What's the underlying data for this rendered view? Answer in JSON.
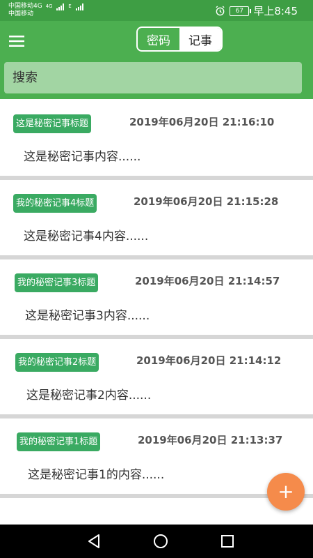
{
  "status_bar": {
    "carrier_line1": "中国移动4G",
    "carrier_line2": "中国移动",
    "net_type_1": "4G",
    "net_type_2": "E",
    "battery": "67",
    "time": "早上8:45",
    "icons": [
      "alarm-icon",
      "battery-icon",
      "signal-icon"
    ]
  },
  "toolbar": {
    "menu_icon": "hamburger-menu-icon",
    "tabs": [
      {
        "label": "密码",
        "active": false
      },
      {
        "label": "记事",
        "active": true
      }
    ]
  },
  "search": {
    "placeholder": "搜索"
  },
  "notes": [
    {
      "title": "这是秘密记事标题",
      "time": "2019年06月20日 21:16:10",
      "content": "这是秘密记事内容......"
    },
    {
      "title": "我的秘密记事4标题",
      "time": "2019年06月20日 21:15:28",
      "content": "这是秘密记事4内容......"
    },
    {
      "title": "我的秘密记事3标题",
      "time": "2019年06月20日 21:14:57",
      "content": "这是秘密记事3内容......"
    },
    {
      "title": "我的秘密记事2标题",
      "time": "2019年06月20日 21:14:12",
      "content": "这是秘密记事2内容......"
    },
    {
      "title": "我的秘密记事1标题",
      "time": "2019年06月20日 21:13:37",
      "content": "这是秘密记事1的内容......"
    }
  ],
  "fab": {
    "label": "+"
  },
  "colors": {
    "status_bar": "#3e9e44",
    "app_bar": "#4caf50",
    "search_box": "#a2d5a3",
    "badge": "#3aaa62",
    "fab": "#f58b4b",
    "divider": "#d6d6d6"
  }
}
